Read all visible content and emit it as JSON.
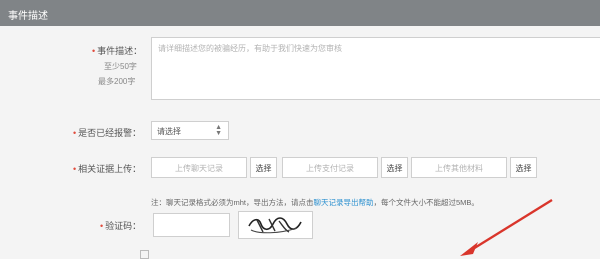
{
  "header": {
    "title": "事件描述"
  },
  "description": {
    "label": "事件描述：",
    "hint_min": "至少50字",
    "hint_max": "最多200字",
    "placeholder": "请详细描述您的被骗经历，有助于我们快速为您审核"
  },
  "reported": {
    "label": "是否已经报警：",
    "selected": "请选择"
  },
  "evidence": {
    "label": "相关证据上传：",
    "chat_placeholder": "上传聊天记录",
    "payment_placeholder": "上传支付记录",
    "other_placeholder": "上传其他材料",
    "browse_label": "选择"
  },
  "note": {
    "prefix": "注：聊天记录格式必须为mht，导出方法，请点击",
    "link": "聊天记录导出帮助",
    "suffix": "，每个文件大小不能超过5MB。"
  },
  "captcha": {
    "label": "验证码："
  },
  "colors": {
    "header_bg": "#808487",
    "required": "#e04b3c",
    "link": "#2a8fcf",
    "arrow": "#d9352b"
  }
}
